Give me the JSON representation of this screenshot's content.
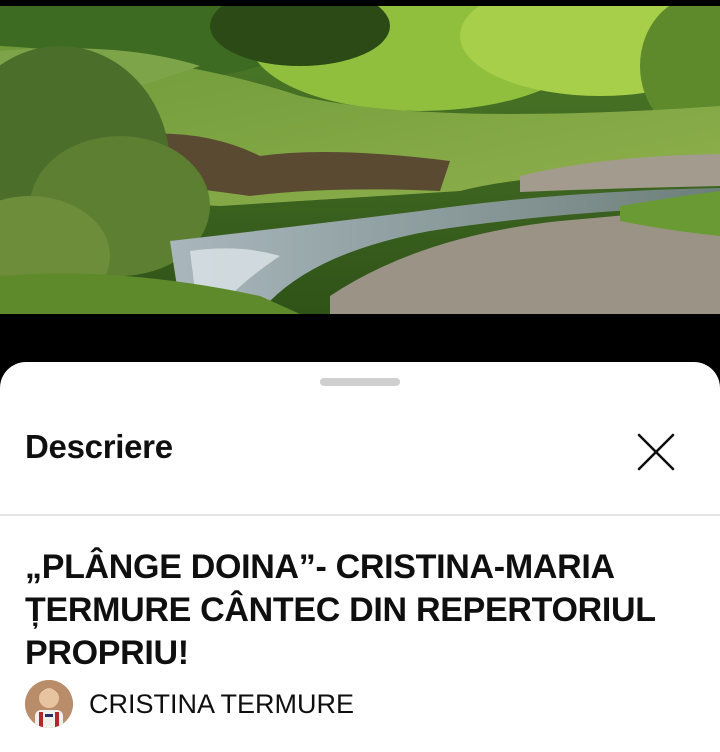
{
  "sheet": {
    "title": "Descriere"
  },
  "video": {
    "title": "„PLÂNGE DOINA”- CRISTINA-MARIA ȚERMURE CÂNTEC DIN REPERTORIUL PROPRIU!",
    "channel_name": "CRISTINA TERMURE"
  },
  "icons": {
    "close": "close-icon",
    "drag": "drag-handle",
    "avatar": "channel-avatar"
  },
  "colors": {
    "sheet_bg": "#ffffff",
    "text": "#0f0f0f",
    "divider": "#e4e4e4",
    "handle": "#cfcfcf"
  }
}
